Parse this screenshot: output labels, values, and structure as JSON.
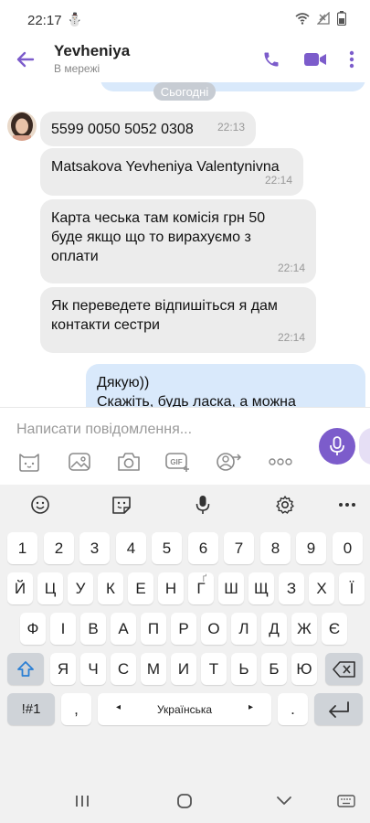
{
  "status_bar": {
    "time": "22:17",
    "notif_glyph": "⛄"
  },
  "header": {
    "contact_name": "Yevheniya",
    "contact_status": "В мережі"
  },
  "chat": {
    "date_chip": "Сьогодні",
    "messages": [
      {
        "text": "5599 0050 5052 0308",
        "time": "22:13"
      },
      {
        "text": "Matsakova Yevheniya Valentynivna",
        "time": "22:14"
      },
      {
        "text_lines": [
          "Карта чеська там комісія грн 50",
          "буде якщо що то вирахуємо з",
          "оплати"
        ],
        "time": "22:14"
      },
      {
        "text_lines": [
          "Як переведете відпишіться я дам",
          "контакти сестри"
        ],
        "time": "22:14"
      }
    ],
    "outgoing": {
      "text_lines": [
        "Дякую))",
        "Скажіть, будь ласка, а можна"
      ]
    }
  },
  "composer": {
    "placeholder": "Написати повідомлення...",
    "gif_label": "GIF"
  },
  "keyboard": {
    "number_row": [
      "1",
      "2",
      "3",
      "4",
      "5",
      "6",
      "7",
      "8",
      "9",
      "0"
    ],
    "row1": [
      "Й",
      "Ц",
      "У",
      "К",
      "Е",
      "Н",
      "Г",
      "Ш",
      "Щ",
      "З",
      "Х",
      "Ї"
    ],
    "row1_hint_g": "Ґ",
    "row2": [
      "Ф",
      "І",
      "В",
      "А",
      "П",
      "Р",
      "О",
      "Л",
      "Д",
      "Ж",
      "Є"
    ],
    "row3": [
      "Я",
      "Ч",
      "С",
      "М",
      "И",
      "Т",
      "Ь",
      "Б",
      "Ю"
    ],
    "symbols_label": "!#1",
    "comma": ",",
    "space_label": "Українська",
    "period": "."
  },
  "colors": {
    "accent": "#7c5ccb",
    "outgoing_bubble": "#d9e9fb",
    "incoming_bubble": "#ececec"
  }
}
